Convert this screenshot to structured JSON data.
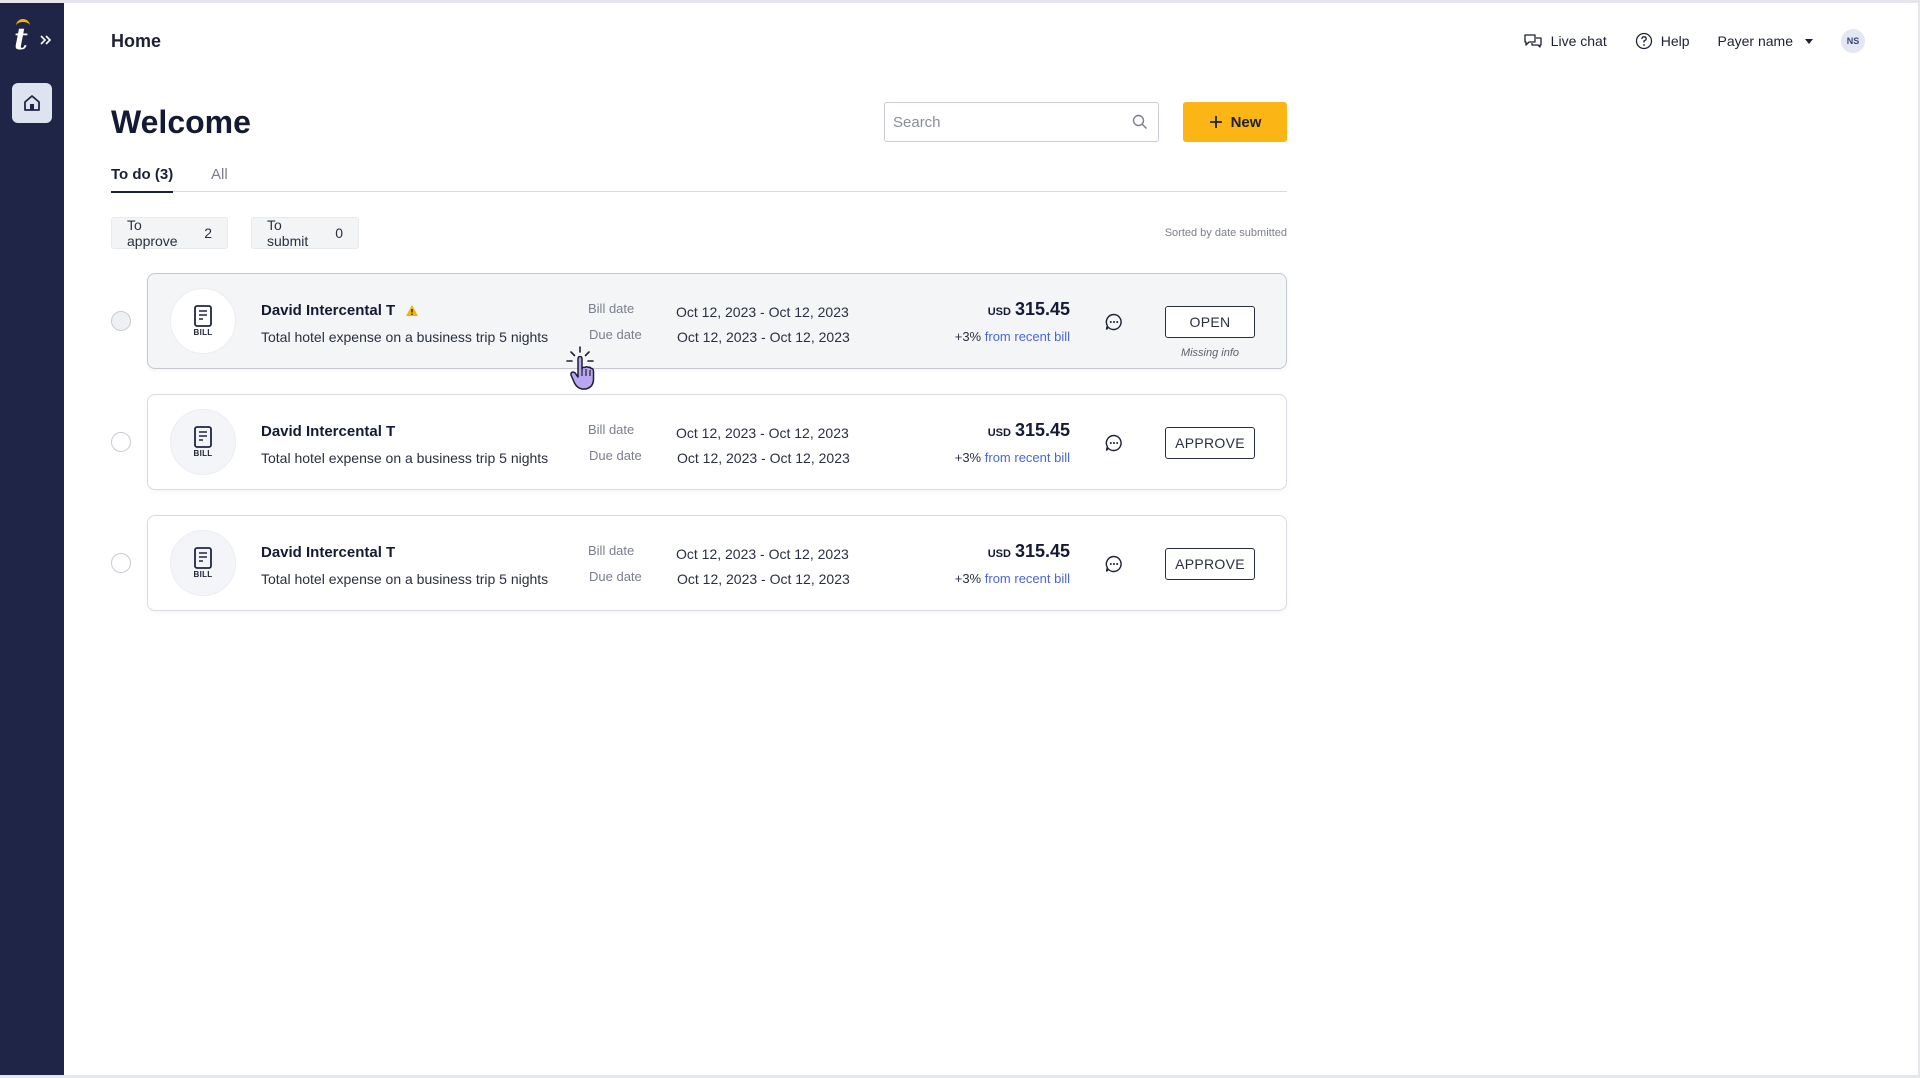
{
  "sidebar": {
    "logo_letter": "t",
    "nav": [
      {
        "name": "home",
        "icon": "home-icon",
        "active": true
      }
    ]
  },
  "header": {
    "page_title": "Home",
    "live_chat": "Live chat",
    "help": "Help",
    "payer_name": "Payer name",
    "avatar_initials": "NS"
  },
  "main": {
    "welcome": "Welcome",
    "search_placeholder": "Search",
    "new_button": "New",
    "tabs": [
      {
        "label": "To do (3)",
        "active": true
      },
      {
        "label": "All",
        "active": false
      }
    ],
    "filters": [
      {
        "label": "To approve",
        "count": "2"
      },
      {
        "label": "To submit",
        "count": "0"
      }
    ],
    "sorted_label": "Sorted by date submitted"
  },
  "bills": [
    {
      "badge": "BILL",
      "vendor": "David Intercental T",
      "warning": true,
      "description": "Total hotel expense on a business trip 5 nights",
      "bill_date_label": "Bill date",
      "bill_date": "Oct 12, 2023 - Oct 12, 2023",
      "due_date_label": "Due date",
      "due_date": "Oct 12, 2023 - Oct 12, 2023",
      "currency": "USD",
      "amount": "315.45",
      "delta": "+3%",
      "delta_link": "from recent bill",
      "action": "OPEN",
      "note": "Missing info"
    },
    {
      "badge": "BILL",
      "vendor": "David Intercental T",
      "warning": false,
      "description": "Total hotel expense on a business trip 5 nights",
      "bill_date_label": "Bill date",
      "bill_date": "Oct 12, 2023 - Oct 12, 2023",
      "due_date_label": "Due date",
      "due_date": "Oct 12, 2023 - Oct 12, 2023",
      "currency": "USD",
      "amount": "315.45",
      "delta": "+3%",
      "delta_link": "from recent bill",
      "action": "APPROVE",
      "note": ""
    },
    {
      "badge": "BILL",
      "vendor": "David Intercental T",
      "warning": false,
      "description": "Total hotel expense on a business trip 5 nights",
      "bill_date_label": "Bill date",
      "bill_date": "Oct 12, 2023 - Oct 12, 2023",
      "due_date_label": "Due date",
      "due_date": "Oct 12, 2023 - Oct 12, 2023",
      "currency": "USD",
      "amount": "315.45",
      "delta": "+3%",
      "delta_link": "from recent bill",
      "action": "APPROVE",
      "note": ""
    }
  ],
  "colors": {
    "sidebar": "#1e2547",
    "accent": "#fbb515",
    "link": "#4a67d6",
    "warning": "#f4b400",
    "cursor": "#b9a7f2"
  }
}
